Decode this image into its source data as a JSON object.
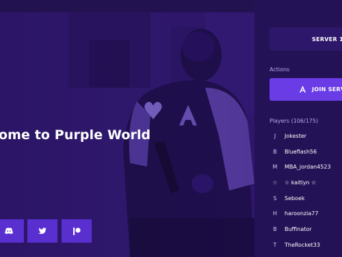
{
  "hero": {
    "title": "ome to Purple World"
  },
  "social": [
    {
      "icon": "discord-icon"
    },
    {
      "icon": "twitter-icon"
    },
    {
      "icon": "patreon-icon"
    }
  ],
  "panel": {
    "server_label": "SERVER 1",
    "actions_label": "Actions",
    "join_label": "JOIN SERV",
    "players_label": "Players (106/175)",
    "players": [
      {
        "initial": "J",
        "name": "Jokester"
      },
      {
        "initial": "B",
        "name": "Blueflash56"
      },
      {
        "initial": "M",
        "name": "MBA_jordan4523"
      },
      {
        "initial": "☆",
        "name": "☆ kaitlyn ☆"
      },
      {
        "initial": "S",
        "name": "Seboek"
      },
      {
        "initial": "H",
        "name": "haroonzia77"
      },
      {
        "initial": "B",
        "name": "Buffinator"
      },
      {
        "initial": "T",
        "name": "TheRocket33"
      }
    ]
  },
  "colors": {
    "background": "#2a1560",
    "panel": "#241256",
    "accent": "#6a3ce6",
    "social_button": "#5a2fd0"
  }
}
